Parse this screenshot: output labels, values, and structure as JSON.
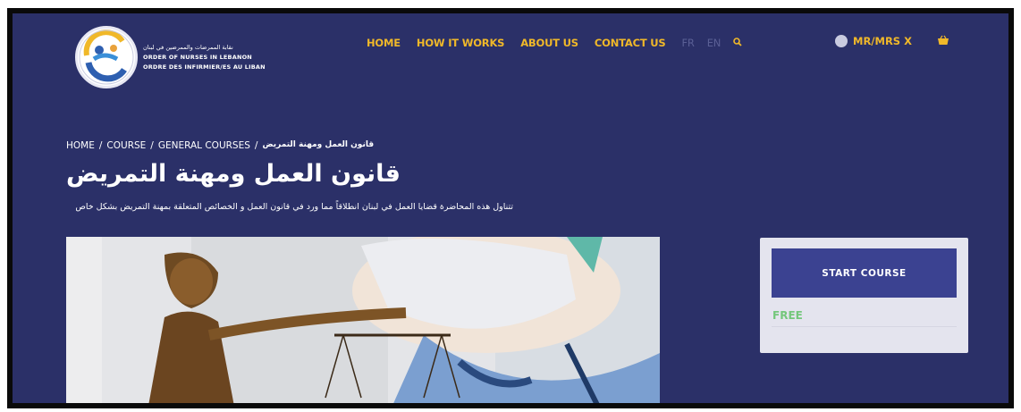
{
  "logo": {
    "line_ar": "نقابة الممرضات والممرضين في لبنان",
    "line_en": "ORDER OF NURSES IN LEBANON",
    "line_fr": "ORDRE DES INFIRMIER/ES AU LIBAN"
  },
  "nav": {
    "items": [
      "HOME",
      "HOW IT WORKS",
      "ABOUT US",
      "CONTACT US"
    ],
    "lang_fr": "FR",
    "lang_en": "EN",
    "search_icon": "search-icon"
  },
  "user": {
    "name": "MR/MRS X",
    "cart_icon": "basket-icon"
  },
  "breadcrumb": {
    "home": "HOME",
    "course": "COURSE",
    "category": "GENERAL COURSES",
    "current": "قانون العمل ومهنة التمريض",
    "separator": "/"
  },
  "course": {
    "title": "قانون العمل ومهنة التمريض",
    "description": "تتناول هذه المحاضرة قضايا العمل في لبنان انطلاقاً مما ورد في قانون العمل و الخصائص المتعلقة بمهنة التمريض بشكل خاص"
  },
  "sidebar": {
    "start_label": "START COURSE",
    "price": "FREE"
  },
  "colors": {
    "background": "#2b3068",
    "accent": "#f0b829",
    "button": "#3b4291",
    "free": "#74c77b"
  }
}
